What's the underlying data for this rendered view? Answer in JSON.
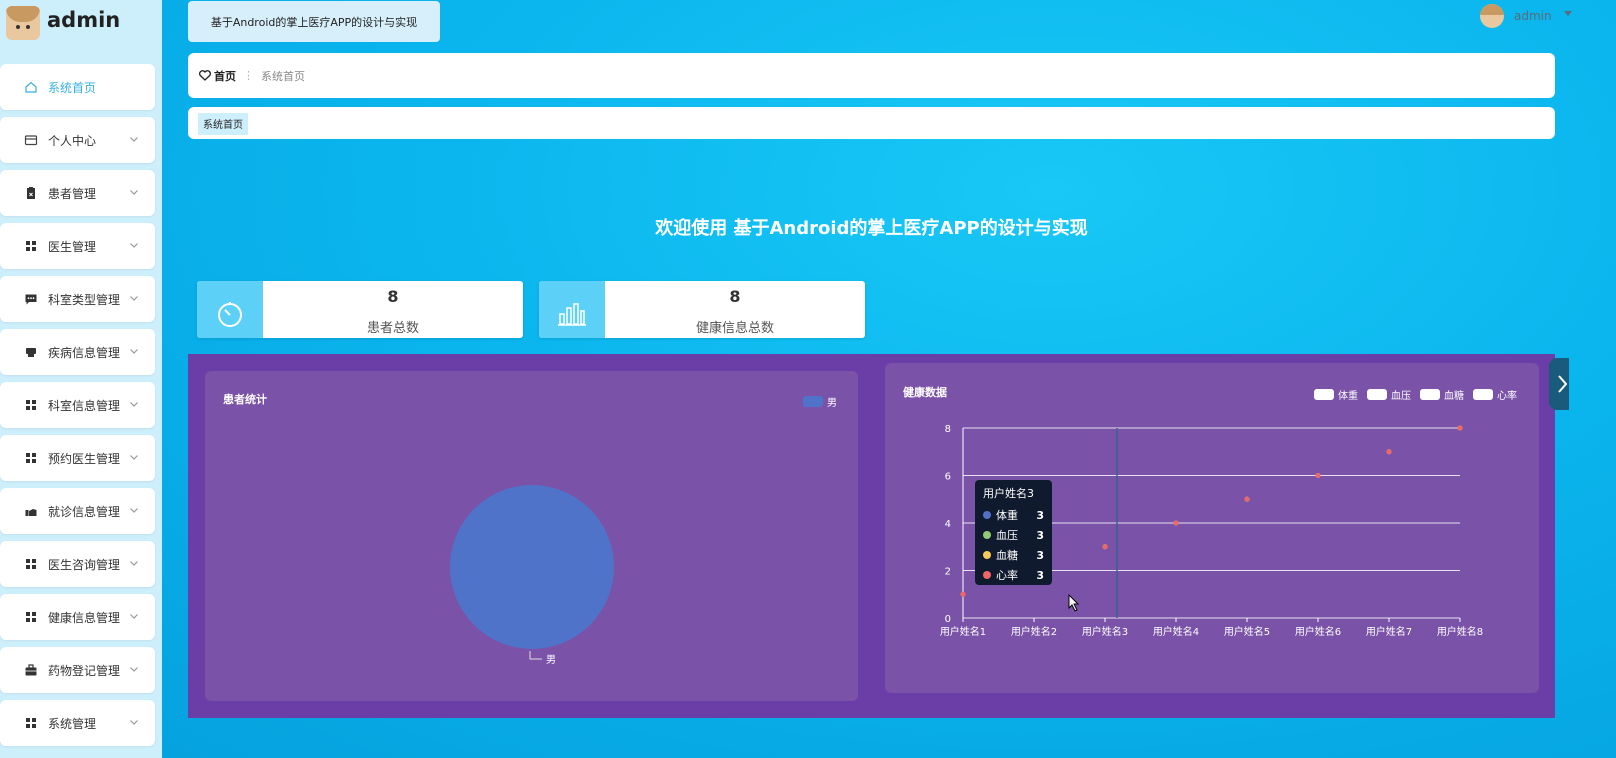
{
  "sidebar": {
    "brand": "admin",
    "items": [
      {
        "label": "系统首页",
        "icon": "home-icon",
        "active": true,
        "chevron": false
      },
      {
        "label": "个人中心",
        "icon": "wallet-icon",
        "chevron": true
      },
      {
        "label": "患者管理",
        "icon": "clipboard-icon",
        "chevron": true
      },
      {
        "label": "医生管理",
        "icon": "grid-icon",
        "chevron": true
      },
      {
        "label": "科室类型管理",
        "icon": "chat-icon",
        "chevron": true
      },
      {
        "label": "疾病信息管理",
        "icon": "printer-icon",
        "chevron": true
      },
      {
        "label": "科室信息管理",
        "icon": "grid-icon",
        "chevron": true
      },
      {
        "label": "预约医生管理",
        "icon": "grid-icon",
        "chevron": true
      },
      {
        "label": "就诊信息管理",
        "icon": "hand-icon",
        "chevron": true
      },
      {
        "label": "医生咨询管理",
        "icon": "grid-icon",
        "chevron": true
      },
      {
        "label": "健康信息管理",
        "icon": "grid-icon",
        "chevron": true
      },
      {
        "label": "药物登记管理",
        "icon": "briefcase-icon",
        "chevron": true
      },
      {
        "label": "系统管理",
        "icon": "grid-icon",
        "chevron": true
      }
    ]
  },
  "header": {
    "system_title": "基于Android的掌上医疗APP的设计与实现",
    "user_name": "admin"
  },
  "breadcrumb": {
    "home": "首页",
    "separator": "⋮",
    "current": "系统首页"
  },
  "tabs": [
    {
      "label": "系统首页"
    }
  ],
  "welcome": "欢迎使用 基于Android的掌上医疗APP的设计与实现",
  "stats": [
    {
      "value": "8",
      "label": "患者总数",
      "icon": "stopwatch-icon"
    },
    {
      "value": "8",
      "label": "健康信息总数",
      "icon": "bar-chart-icon"
    }
  ],
  "colors": {
    "accent": "#39b0dd",
    "card_icon_bg": "#5dd0f7",
    "chart_bg": "#6a3ea6",
    "panel_bg": "#7a52a8"
  },
  "chart_data": [
    {
      "type": "pie",
      "title": "患者统计",
      "legend_position": "top-right",
      "slices": [
        {
          "name": "男",
          "value": 8,
          "color": "#4f73c8"
        }
      ]
    },
    {
      "type": "scatter",
      "title": "健康数据",
      "legend_position": "top-right",
      "categories": [
        "用户姓名1",
        "用户姓名2",
        "用户姓名3",
        "用户姓名4",
        "用户姓名5",
        "用户姓名6",
        "用户姓名7",
        "用户姓名8"
      ],
      "yticks": [
        "0",
        "2",
        "4",
        "6",
        "8"
      ],
      "ylim": [
        0,
        8
      ],
      "grid": true,
      "series": [
        {
          "name": "体重",
          "color": "#5470c6",
          "values": [
            1,
            2,
            3,
            4,
            5,
            6,
            7,
            8
          ]
        },
        {
          "name": "血压",
          "color": "#91cc75",
          "values": [
            1,
            2,
            3,
            4,
            5,
            6,
            7,
            8
          ]
        },
        {
          "name": "血糖",
          "color": "#fac858",
          "values": [
            1,
            2,
            3,
            4,
            5,
            6,
            7,
            8
          ]
        },
        {
          "name": "心率",
          "color": "#ee6666",
          "values": [
            1,
            2,
            3,
            4,
            5,
            6,
            7,
            8
          ]
        }
      ],
      "tooltip": {
        "title": "用户姓名3",
        "rows": [
          {
            "name": "体重",
            "value": "3",
            "color": "#5470c6"
          },
          {
            "name": "血压",
            "value": "3",
            "color": "#91cc75"
          },
          {
            "name": "血糖",
            "value": "3",
            "color": "#fac858"
          },
          {
            "name": "心率",
            "value": "3",
            "color": "#ee6666"
          }
        ]
      }
    }
  ]
}
